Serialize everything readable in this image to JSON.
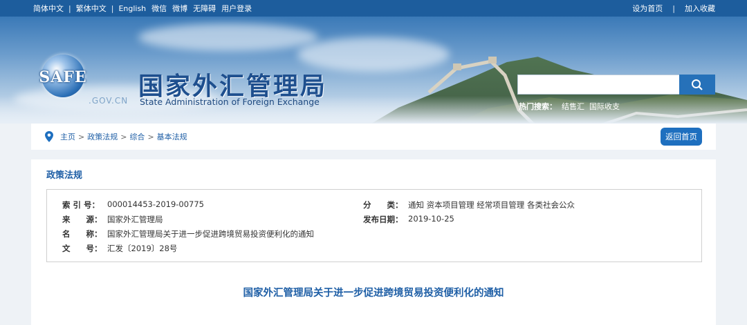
{
  "topbar": {
    "links_left": [
      "简体中文",
      "繁体中文",
      "English",
      "微信",
      "微博",
      "无障碍",
      "用户登录"
    ],
    "links_right": [
      "设为首页",
      "加入收藏"
    ]
  },
  "header": {
    "logo_text": "SAFE",
    "logo_domain": ".GOV.CN",
    "site_name_cn": "国家外汇管理局",
    "site_name_en": "State Administration of Foreign Exchange",
    "search_placeholder": "",
    "hot_label": "热门搜索：",
    "hot_keywords": [
      "结售汇",
      "国际收支"
    ]
  },
  "breadcrumb": {
    "items": [
      "主页",
      "政策法规",
      "综合",
      "基本法规"
    ],
    "separator": ">",
    "back_home": "返回首页"
  },
  "section": {
    "title": "政策法规"
  },
  "meta": {
    "index_label": "索 引 号：",
    "index_value": "000014453-2019-00775",
    "category_label": "分　　类：",
    "category_value": "通知  资本项目管理  经常项目管理  各类社会公众",
    "source_label": "来　　源：",
    "source_value": "国家外汇管理局",
    "date_label": "发布日期：",
    "date_value": "2019-10-25",
    "name_label": "名　　称：",
    "name_value": "国家外汇管理局关于进一步促进跨境贸易投资便利化的通知",
    "doc_label": "文　　号：",
    "doc_value": "汇发〔2019〕28号"
  },
  "document": {
    "title": "国家外汇管理局关于进一步促进跨境贸易投资便利化的通知"
  },
  "colors": {
    "topbar": "#1d5d9d",
    "accent": "#1f5fa6",
    "button": "#1e6fbf"
  }
}
